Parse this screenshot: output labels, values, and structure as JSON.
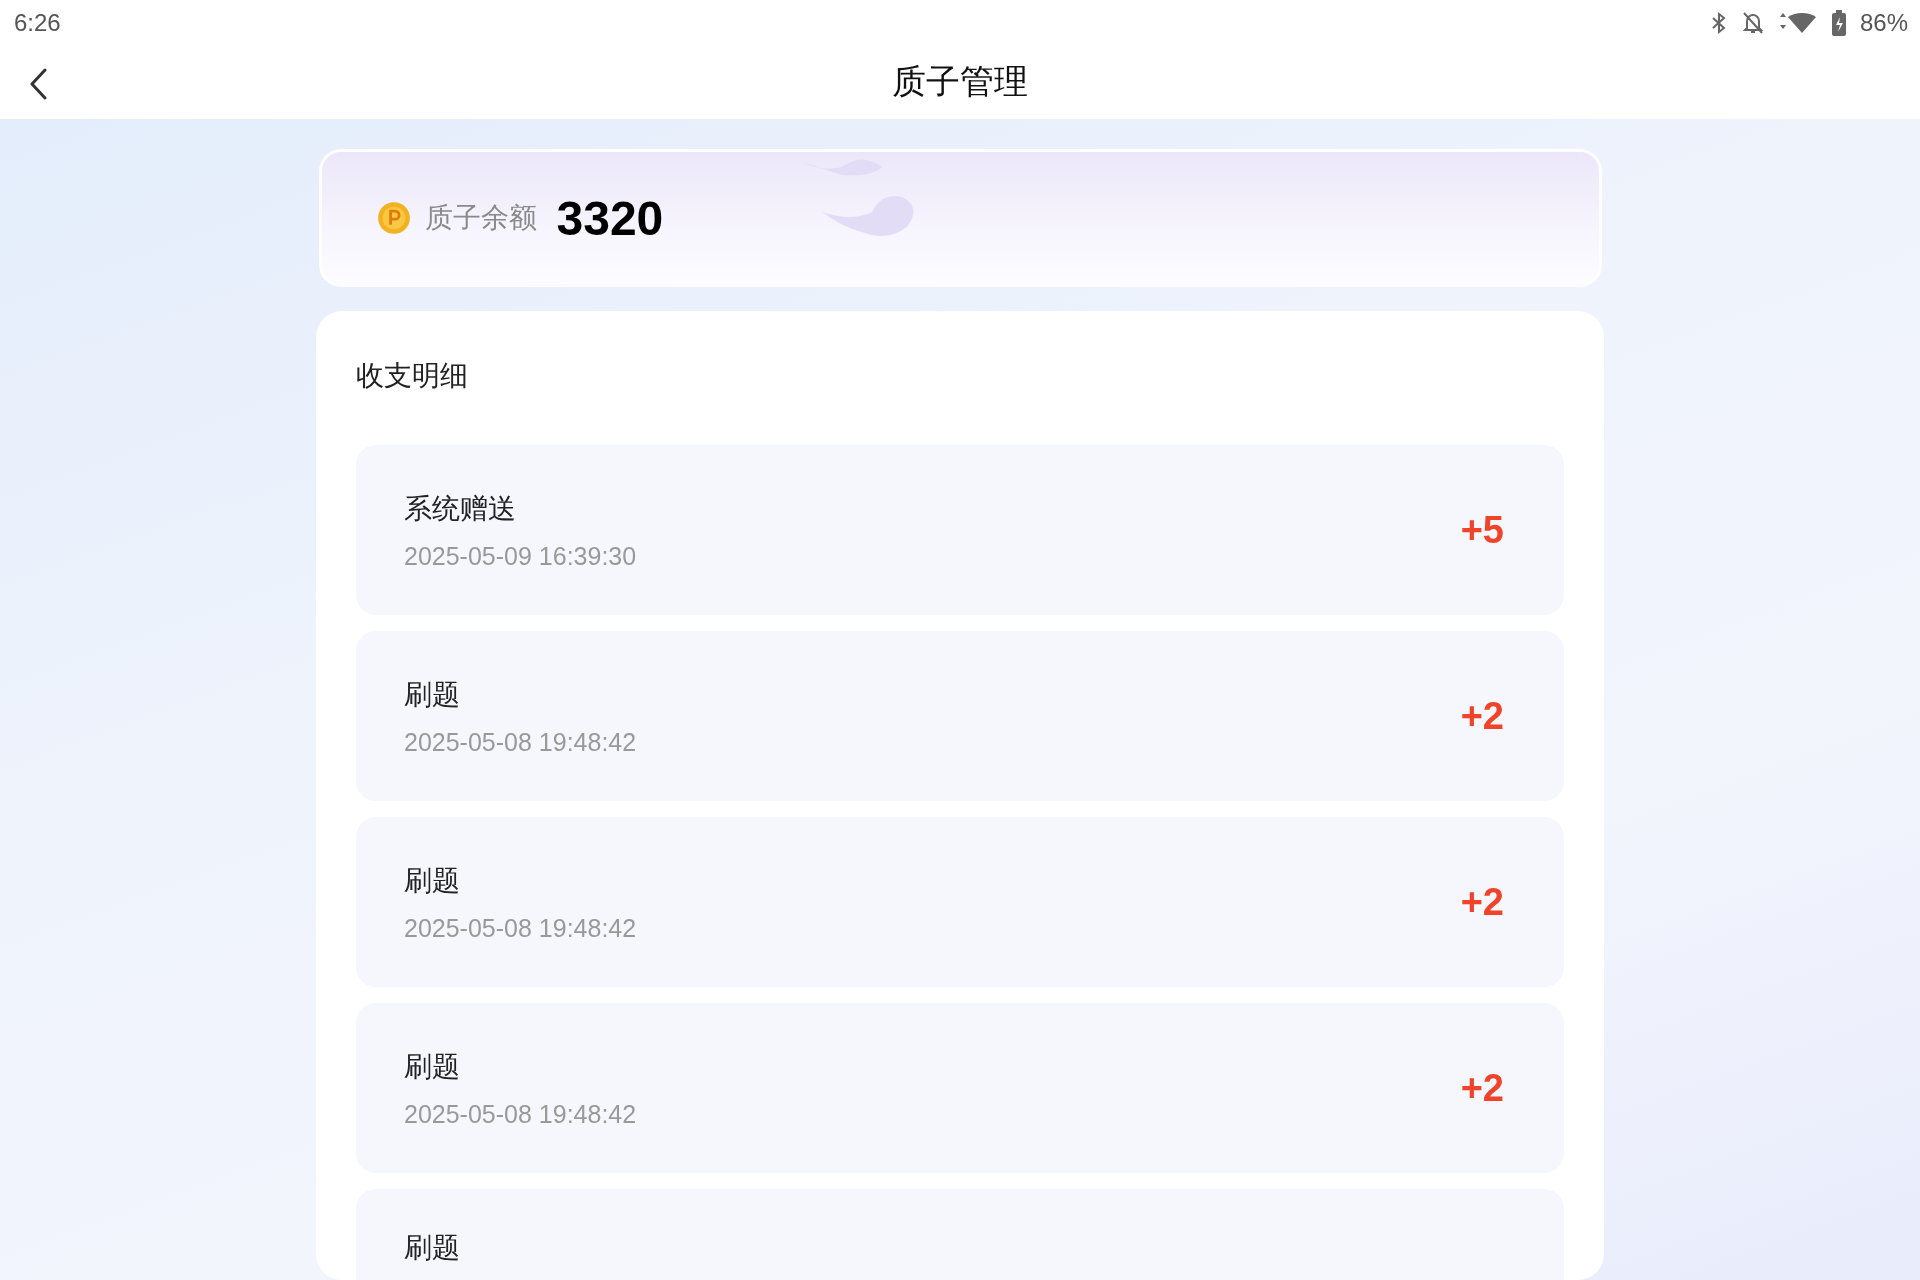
{
  "status_bar": {
    "time": "6:26",
    "battery": "86%"
  },
  "header": {
    "title": "质子管理"
  },
  "balance": {
    "label": "质子余额",
    "value": "3320"
  },
  "ledger": {
    "title": "收支明细",
    "items": [
      {
        "title": "系统赠送",
        "time": "2025-05-09 16:39:30",
        "amount": "+5"
      },
      {
        "title": "刷题",
        "time": "2025-05-08 19:48:42",
        "amount": "+2"
      },
      {
        "title": "刷题",
        "time": "2025-05-08 19:48:42",
        "amount": "+2"
      },
      {
        "title": "刷题",
        "time": "2025-05-08 19:48:42",
        "amount": "+2"
      },
      {
        "title": "刷题"
      }
    ]
  }
}
